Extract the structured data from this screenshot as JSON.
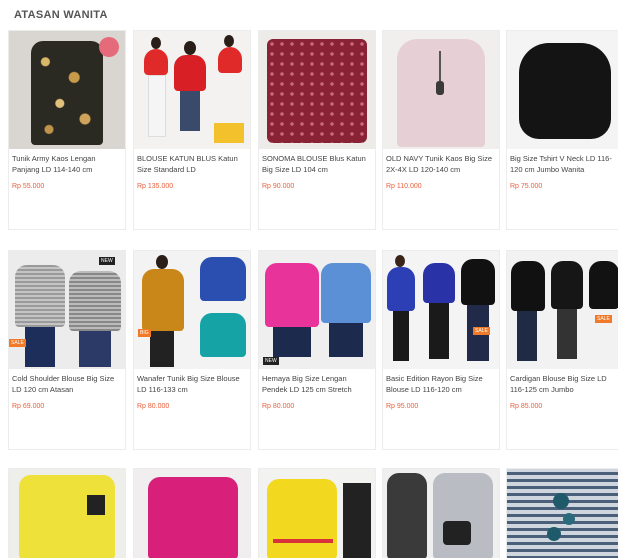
{
  "section": {
    "title": "ATASAN WANITA"
  },
  "products": [
    {
      "name": "Tunik Army Kaos Lengan Panjang LD 114-140 cm",
      "price": "Rp 55.000",
      "image": "tunic-army-print-icon"
    },
    {
      "name": "BLOUSE KATUN BLUS Katun Size Standard LD",
      "price": "Rp 135.000",
      "image": "red-blouse-models-icon"
    },
    {
      "name": "SONOMA BLOUSE Blus Katun Big Size LD 104 cm",
      "price": "Rp 90.000",
      "image": "maroon-floral-blouse-icon"
    },
    {
      "name": "OLD NAVY Tunik Kaos Big Size 2X-4X LD 120-140 cm",
      "price": "Rp 110.000",
      "image": "pink-tunic-necklace-icon"
    },
    {
      "name": "Big Size Tshirt V Neck LD 116-120 cm Jumbo Wanita",
      "price": "Rp 75.000",
      "image": "black-vneck-tshirt-icon"
    },
    {
      "name": "Cold Shoulder Blouse Big Size LD 120 cm Atasan",
      "price": "Rp 69.000",
      "image": "grey-stripe-blouse-icon"
    },
    {
      "name": "Wanafer Tunik Big Size Blouse LD 116-133 cm",
      "price": "Rp 80.000",
      "image": "mustard-blue-tunic-icon"
    },
    {
      "name": "Hemaya Big Size Lengan Pendek LD 125 cm Stretch",
      "price": "Rp 80.000",
      "image": "pink-blue-shirt-icon"
    },
    {
      "name": "Basic Edition Rayon Big Size Blouse LD 116-120 cm",
      "price": "Rp 95.000",
      "image": "blue-black-rayon-blouse-icon"
    },
    {
      "name": "Cardigan Blouse Big Size LD 116-125 cm Jumbo",
      "price": "Rp 85.000",
      "image": "black-cardigan-icon"
    },
    {
      "name": "",
      "price": "",
      "image": "yellow-hoodie-icon"
    },
    {
      "name": "",
      "price": "",
      "image": "magenta-blouse-icon"
    },
    {
      "name": "",
      "price": "",
      "image": "yellow-jacket-icon"
    },
    {
      "name": "",
      "price": "",
      "image": "grey-coat-bag-icon"
    },
    {
      "name": "",
      "price": "",
      "image": "stripe-floral-top-icon"
    }
  ],
  "colors": {
    "price": "#e8603c",
    "accent_tag": "#f07a2a"
  }
}
